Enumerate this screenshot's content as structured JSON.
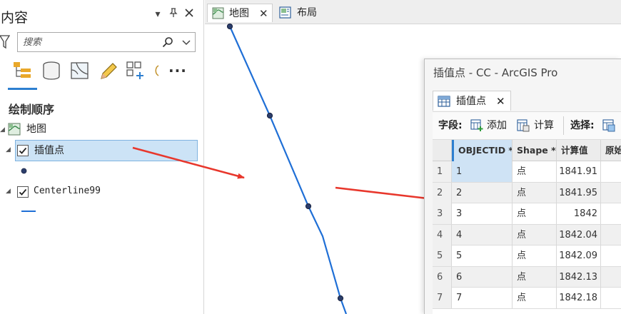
{
  "contents_pane": {
    "title": "内容",
    "search": {
      "placeholder": "搜索"
    },
    "section_title": "绘制顺序",
    "map_name": "地图",
    "layers": [
      {
        "name": "插值点",
        "checked": true,
        "selected": true
      },
      {
        "name": "Centerline99",
        "checked": true,
        "selected": false
      }
    ]
  },
  "map_view": {
    "tabs": [
      {
        "label": "地图",
        "active": true
      },
      {
        "label": "布局",
        "active": false
      }
    ],
    "line_color": "#1f6fd6",
    "point_color": "#2c3e6b",
    "arrow_color": "#e8372c"
  },
  "attribute_window": {
    "title": "插值点 - CC - ArcGIS Pro",
    "tab_label": "插值点",
    "toolbar": {
      "fields_label": "字段:",
      "add_label": "添加",
      "calculate_label": "计算",
      "select_label": "选择:"
    },
    "columns": [
      "OBJECTID *",
      "Shape *",
      "计算值",
      "原始"
    ],
    "rows": [
      {
        "num": "1",
        "objectid": "1",
        "shape": "点",
        "value": "1841.91"
      },
      {
        "num": "2",
        "objectid": "2",
        "shape": "点",
        "value": "1841.95"
      },
      {
        "num": "3",
        "objectid": "3",
        "shape": "点",
        "value": "1842"
      },
      {
        "num": "4",
        "objectid": "4",
        "shape": "点",
        "value": "1842.04"
      },
      {
        "num": "5",
        "objectid": "5",
        "shape": "点",
        "value": "1842.09"
      },
      {
        "num": "6",
        "objectid": "6",
        "shape": "点",
        "value": "1842.13"
      },
      {
        "num": "7",
        "objectid": "7",
        "shape": "点",
        "value": "1842.18"
      }
    ]
  }
}
